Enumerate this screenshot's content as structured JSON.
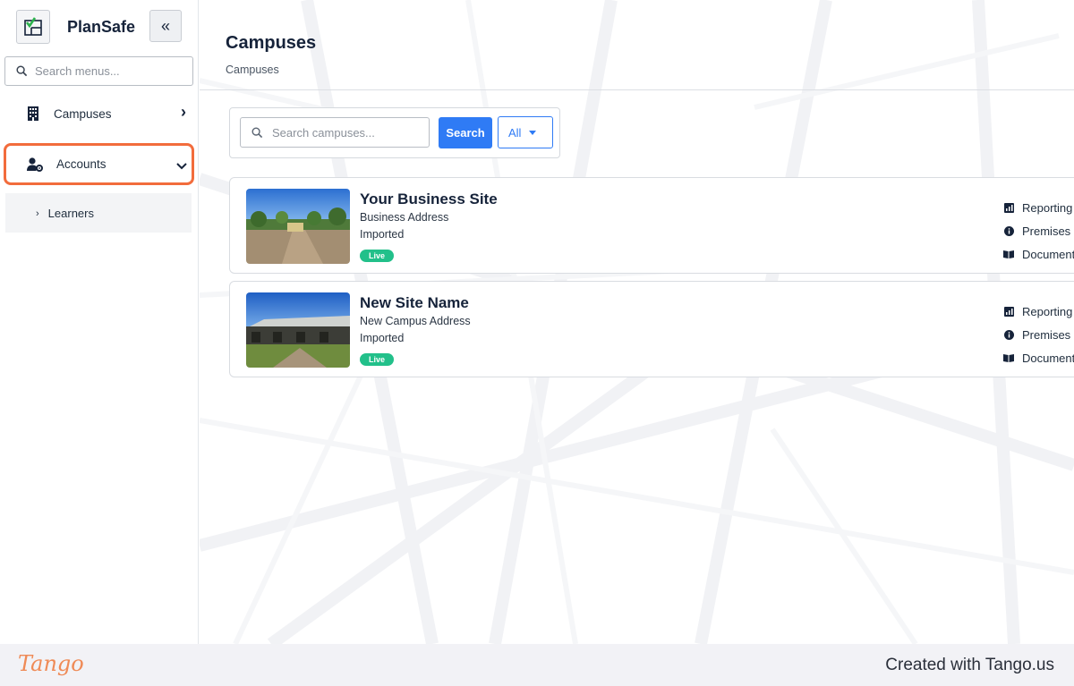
{
  "sidebar": {
    "brand": "PlanSafe",
    "collapse_icon": "«",
    "search_placeholder": "Search menus...",
    "items": [
      {
        "label": "Campuses",
        "icon": "building-icon",
        "chevron": "›"
      },
      {
        "label": "Accounts",
        "icon": "user-cog-icon",
        "chevron": "⌄"
      }
    ],
    "submenu": [
      {
        "label": "Learners",
        "caret": "›"
      }
    ]
  },
  "main": {
    "title": "Campuses",
    "breadcrumb": "Campuses",
    "search_placeholder": "Search campuses...",
    "search_button": "Search",
    "filter_label": "All",
    "campuses": [
      {
        "name": "Your Business Site",
        "address": "Business Address",
        "status": "Imported",
        "badge": "Live",
        "actions": [
          "Reporting",
          "Premises",
          "Document"
        ]
      },
      {
        "name": "New Site Name",
        "address": "New Campus Address",
        "status": "Imported",
        "badge": "Live",
        "actions": [
          "Reporting",
          "Premises",
          "Document"
        ]
      }
    ]
  },
  "footer": {
    "logo": "Tango",
    "created_text": "Created with Tango.us"
  },
  "colors": {
    "accent": "#2f7bf5",
    "highlight": "#f26c3c",
    "live": "#22c08a",
    "navy": "#16233a"
  }
}
